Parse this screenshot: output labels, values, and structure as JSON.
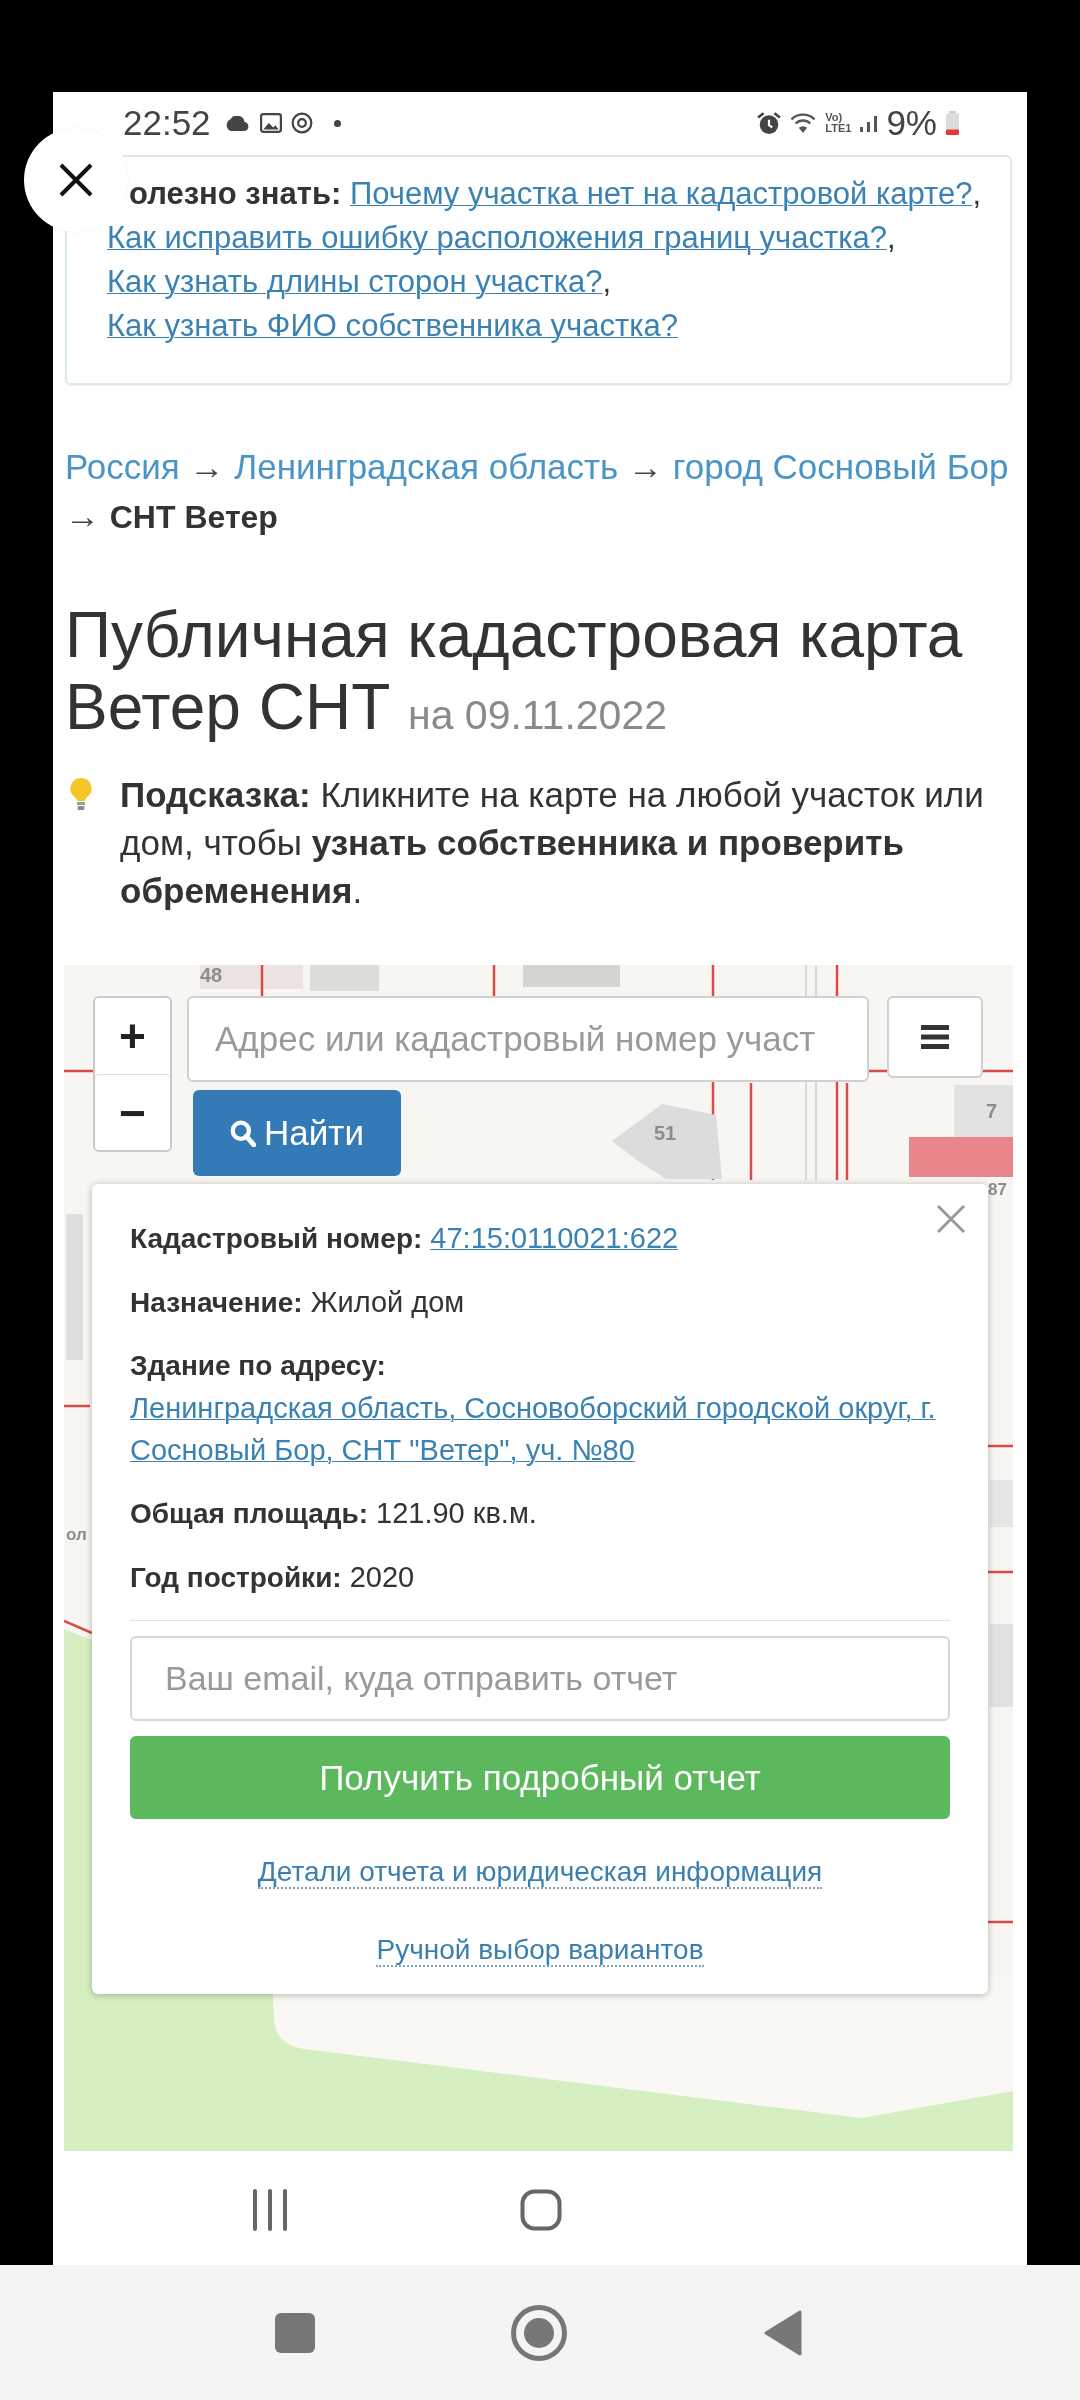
{
  "status_bar": {
    "time": "22:52",
    "network_badge": [
      "Vo)",
      "LTE1"
    ],
    "battery": "9%"
  },
  "info_box": {
    "items": [
      {
        "kind": "label",
        "text": "олезно знать:"
      },
      {
        "kind": "link",
        "text": "Почему участка нет на кадастровой карте?"
      },
      {
        "kind": "text",
        "text": ","
      },
      {
        "kind": "link",
        "text": "Как исправить ошибку расположения границ участка?"
      },
      {
        "kind": "text",
        "text": ","
      },
      {
        "kind": "link",
        "text": "Как узнать длины сторон участка?"
      },
      {
        "kind": "text",
        "text": ","
      },
      {
        "kind": "link",
        "text": "Как узнать ФИО собственника участка?"
      }
    ]
  },
  "breadcrumbs": [
    {
      "kind": "link",
      "text": "Россия"
    },
    {
      "kind": "separator",
      "text": "→"
    },
    {
      "kind": "link",
      "text": "Ленинградская область"
    },
    {
      "kind": "separator",
      "text": "→"
    },
    {
      "kind": "link",
      "text": "город Сосновый Бор"
    },
    {
      "kind": "separator",
      "text": "→"
    },
    {
      "kind": "current",
      "text": "СНТ Ветер"
    }
  ],
  "title": {
    "text": "Публичная кадастровая карта Ветер СНТ",
    "date": "на 09.11.2022"
  },
  "hint": "**Подсказка:** Кликните на карте на любой участок или дом, чтобы **узнать собственника и проверить обременения**.",
  "map": {
    "labels": [
      "48",
      "51",
      "7",
      "87",
      "ол"
    ],
    "zoom_in": "+",
    "zoom_out": "−",
    "search": {
      "placeholder": "Адрес или кадастровый номер участ"
    },
    "search_button": "Найти",
    "popup": {
      "rows": [
        {
          "label": "Кадастровый номер:",
          "value": "47:15:0110021:622",
          "kind": "link"
        },
        {
          "label": "Назначение:",
          "value": "Жилой дом",
          "kind": "text"
        },
        {
          "label": "Здание по адресу:",
          "value": "Ленинградская область, Сосновоборский городской округ, г. Сосновый Бор, СНТ \"Ветер\", уч. №80",
          "kind": "address"
        },
        {
          "label": "Общая площадь:",
          "value": "121.90 кв.м.",
          "kind": "text"
        },
        {
          "label": "Год постройки:",
          "value": "2020",
          "kind": "text"
        }
      ],
      "email": {
        "placeholder": "Ваш email, куда отправить отчет"
      },
      "submit": "Получить подробный отчет",
      "links": [
        "Детали отчета и юридическая информация",
        "Ручной выбор вариантов"
      ]
    }
  }
}
